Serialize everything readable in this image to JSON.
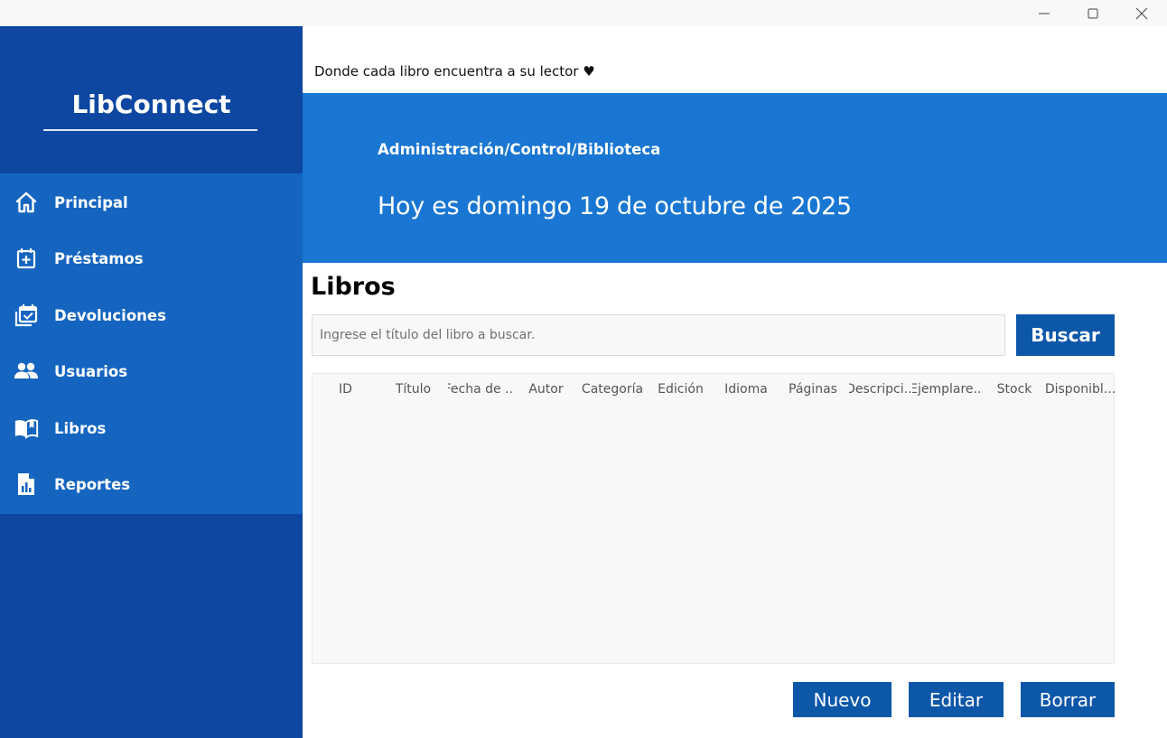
{
  "window": {
    "controls": {
      "minimize": "minimize-icon",
      "maximize": "maximize-icon",
      "close": "close-icon"
    }
  },
  "sidebar": {
    "brand": "LibConnect",
    "items": [
      {
        "label": "Principal",
        "icon": "home-icon"
      },
      {
        "label": "Préstamos",
        "icon": "calendar-add-icon"
      },
      {
        "label": "Devoluciones",
        "icon": "calendar-check-icon"
      },
      {
        "label": "Usuarios",
        "icon": "users-icon"
      },
      {
        "label": "Libros",
        "icon": "book-icon"
      },
      {
        "label": "Reportes",
        "icon": "report-icon"
      }
    ]
  },
  "header": {
    "tagline": "Donde cada libro encuentra a su lector ♥",
    "breadcrumb": "Administración/Control/Biblioteca",
    "date": "Hoy es domingo 19 de octubre de 2025"
  },
  "main": {
    "title": "Libros",
    "search": {
      "placeholder": "Ingrese el título del libro a buscar.",
      "value": ""
    },
    "search_button": "Buscar",
    "table": {
      "columns": [
        "ID",
        "Título",
        "Fecha de ...",
        "Autor",
        "Categoría",
        "Edición",
        "Idioma",
        "Páginas",
        "Descripci...",
        "Ejemplare...",
        "Stock",
        "Disponibl..."
      ],
      "rows": []
    },
    "actions": {
      "new": "Nuevo",
      "edit": "Editar",
      "delete": "Borrar"
    }
  },
  "colors": {
    "sidebar_dark": "#0d47a1",
    "sidebar_nav": "#1565c0",
    "banner": "#1976d2",
    "button": "#0d57a9"
  }
}
